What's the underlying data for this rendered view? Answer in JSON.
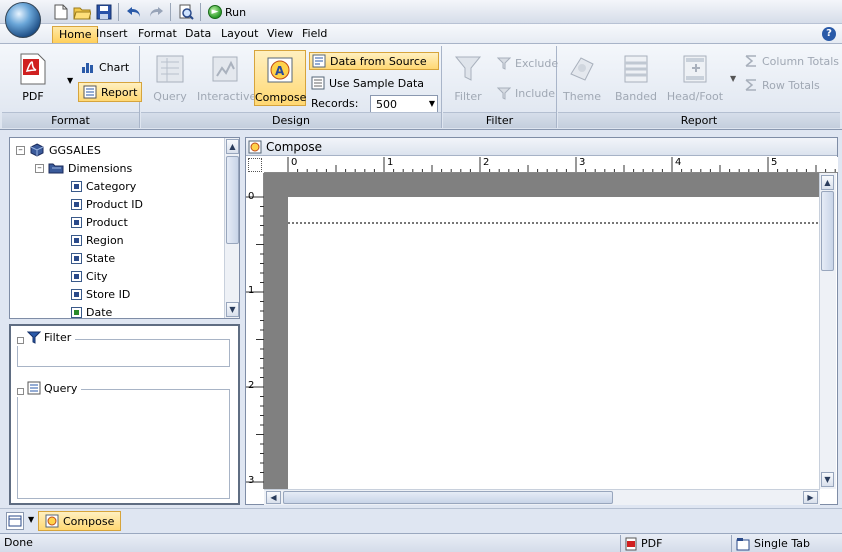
{
  "toolbar": {
    "run_label": "Run"
  },
  "menu": {
    "tabs": [
      "Home",
      "Insert",
      "Format",
      "Data",
      "Layout",
      "View",
      "Field"
    ],
    "active": "Home",
    "help": "?"
  },
  "ribbon": {
    "format": {
      "caption": "Format",
      "pdf_label": "PDF",
      "chart_label": "Chart",
      "report_label": "Report"
    },
    "design": {
      "caption": "Design",
      "query_label": "Query",
      "interactive_label": "Interactive",
      "compose_label": "Compose",
      "data_from_source_label": "Data from Source",
      "use_sample_data_label": "Use Sample Data",
      "records_label": "Records:",
      "records_value": "500"
    },
    "filter": {
      "caption": "Filter",
      "filter_label": "Filter",
      "exclude_label": "Exclude",
      "include_label": "Include"
    },
    "report": {
      "caption": "Report",
      "theme_label": "Theme",
      "banded_label": "Banded",
      "headfoot_label": "Head/Foot",
      "column_totals_label": "Column Totals",
      "row_totals_label": "Row Totals"
    }
  },
  "tree": {
    "root": "GGSALES",
    "folder": "Dimensions",
    "fields": [
      "Category",
      "Product ID",
      "Product",
      "Region",
      "State",
      "City",
      "Store ID",
      "Date"
    ]
  },
  "panels": {
    "filter_label": "Filter",
    "query_label": "Query"
  },
  "compose": {
    "title": "Compose",
    "ruler_h": [
      "0",
      "1",
      "2",
      "3",
      "4",
      "5"
    ],
    "ruler_v": [
      "0",
      "1",
      "2",
      "3"
    ]
  },
  "tabs": {
    "active_tab": "Compose"
  },
  "status": {
    "left": "Done",
    "format": "PDF",
    "layout": "Single Tab"
  }
}
